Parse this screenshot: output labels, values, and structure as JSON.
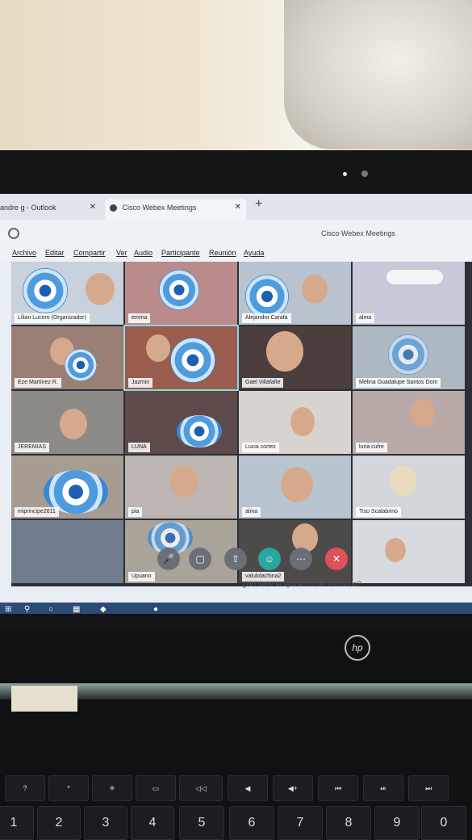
{
  "tabs": [
    {
      "label": "andre g - Outlook",
      "close": "✕"
    },
    {
      "label": "Cisco Webex Meetings",
      "close": "✕"
    }
  ],
  "new_tab": "+",
  "window_title": "Cisco Webex Meetings",
  "menu": [
    "Archivo",
    "Editar",
    "Compartir",
    "Ver",
    "Audio",
    "Participante",
    "Reunión",
    "Ayuda"
  ],
  "participants": [
    "Lilian Lucero (Organizador)",
    "emma",
    "Alejandro Carafa",
    "alma",
    "Eze Martinez R.",
    "Jazmin",
    "Gael Villafañe",
    "Melina Guadalupe Santos Dom",
    "JEREMIAS",
    "LUNA",
    "Lucia cortez",
    "luna cufre",
    "miprincipe2611",
    "pia",
    "alma",
    "Tiso Scalabrino",
    "",
    "Upuano",
    "valulolachina2",
    ""
  ],
  "controls": [
    "mute-icon",
    "video-icon",
    "share-icon",
    "participants-icon",
    "more-icon",
    "end-call-icon"
  ],
  "hint_text": "¿No tiene la aplicación de escritorio?",
  "keyboard": {
    "fn_row": [
      "?",
      "*",
      "✳",
      "▭",
      "◁◁",
      "◀",
      "◀+",
      "⏮",
      "⏯",
      "⏭"
    ],
    "num_row": [
      "1",
      "2",
      "3",
      "4",
      "5",
      "6",
      "7",
      "8",
      "9",
      "0"
    ],
    "num_row_top": [
      "!",
      "\"",
      "#",
      "$",
      "%",
      "&",
      "/",
      "(",
      ")",
      "="
    ]
  },
  "brand": "hp"
}
